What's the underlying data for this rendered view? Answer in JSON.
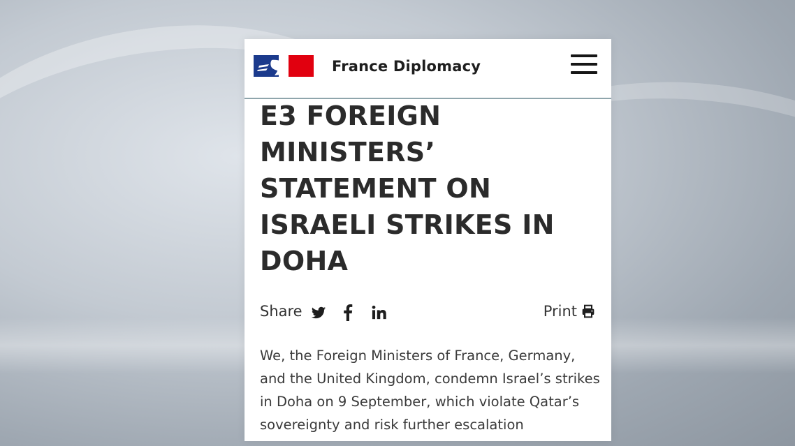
{
  "header": {
    "site_name": "France Diplomacy",
    "logo_icon": "marianne-logo-icon",
    "menu_icon": "hamburger-menu-icon",
    "flag_colors": {
      "blue": "#1b3a8c",
      "red": "#e1000f"
    }
  },
  "article": {
    "title": "E3 FOREIGN MINISTERS’ STATEMENT ON ISRAELI STRIKES IN DOHA",
    "share_label": "Share",
    "share_icons": [
      "twitter-icon",
      "facebook-icon",
      "linkedin-icon"
    ],
    "print_label": "Print",
    "print_icon": "printer-icon",
    "body": "We, the Foreign Ministers of France, Germany, and the United Kingdom, condemn Israel’s strikes in Doha on 9 September, which violate Qatar’s sovereignty and risk further escalation"
  }
}
